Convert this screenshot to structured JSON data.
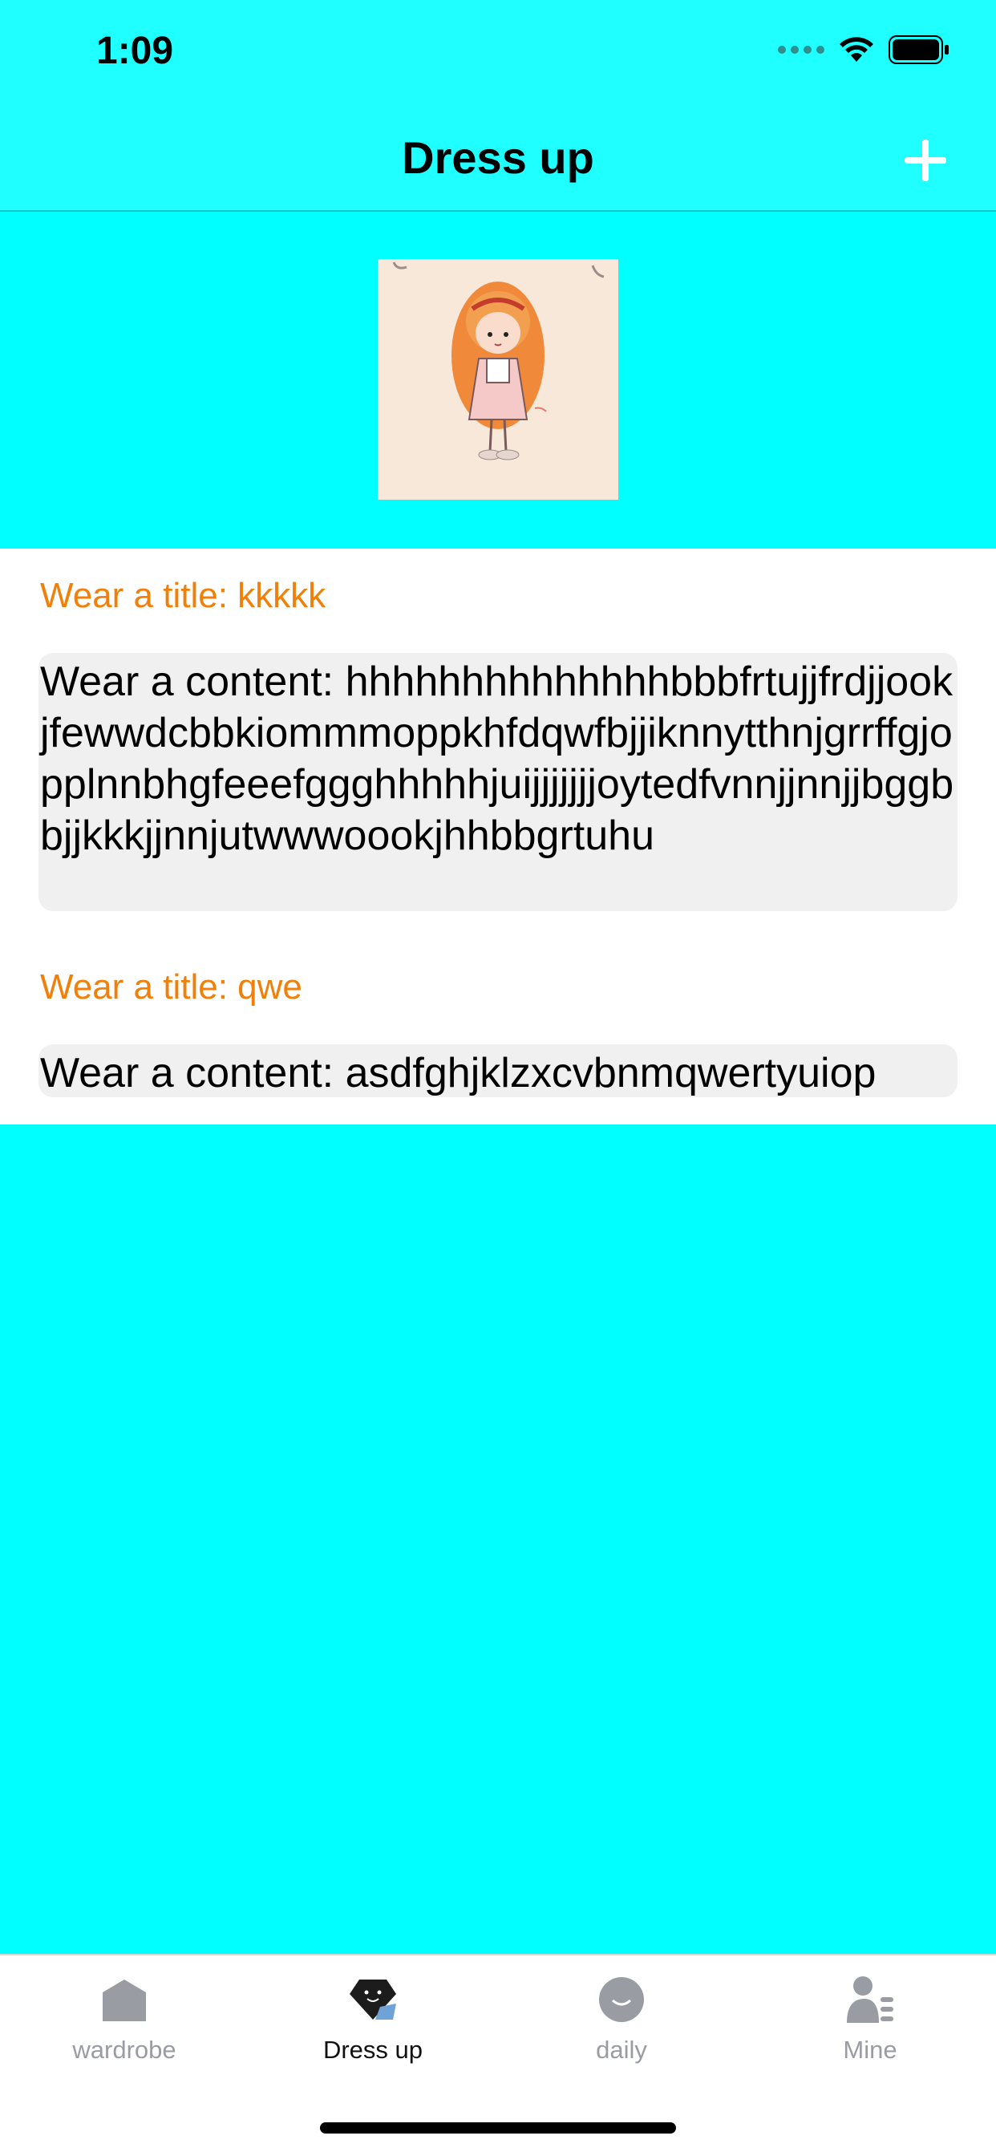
{
  "status_bar": {
    "time": "1:09"
  },
  "nav": {
    "title": "Dress up",
    "add_icon": "plus-icon"
  },
  "entries": [
    {
      "title": "Wear a title: kkkkk",
      "content": "Wear a content: hhhhhhhhhhhhhhbbbfrtujjfrdjjookjfewwdcbbkiommmoppkhfdqwfbjjiknnytthnjgrrffgjopplnnbhgfeeefggghhhhhjuijjjjjjjoytedfvnnjjnnjjbggbbjjkkkjjnnjutwwwoookjhhbbgrtuhu"
    },
    {
      "title": "Wear a title: qwe",
      "content": "Wear a content: asdfghjklzxcvbnmqwertyuiop"
    }
  ],
  "tabs": [
    {
      "label": "wardrobe",
      "icon": "house-icon",
      "active": false
    },
    {
      "label": "Dress up",
      "icon": "diamond-smile-icon",
      "active": true
    },
    {
      "label": "daily",
      "icon": "smile-icon",
      "active": false
    },
    {
      "label": "Mine",
      "icon": "person-icon",
      "active": false
    }
  ],
  "colors": {
    "nav_background": "#1FFFFF",
    "page_background": "#00FFFF",
    "title_accent": "#F0800A",
    "content_background": "#F0F0F0"
  }
}
